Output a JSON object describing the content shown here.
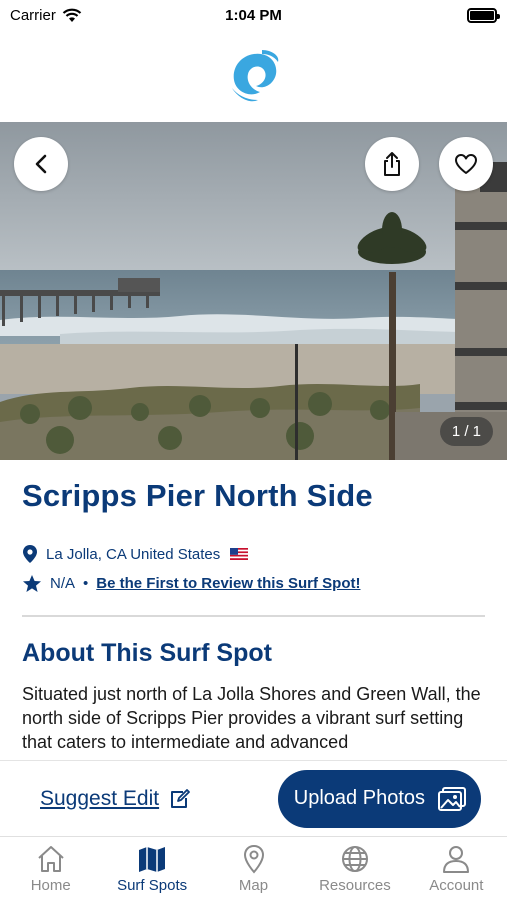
{
  "status_bar": {
    "carrier": "Carrier",
    "time": "1:04 PM"
  },
  "header": {
    "logo_icon": "wave-swirl-logo-icon"
  },
  "hero": {
    "photo_counter": "1 / 1",
    "buttons": {
      "back": "back-icon",
      "share": "share-icon",
      "favorite": "heart-icon"
    }
  },
  "spot": {
    "title": "Scripps Pier North Side",
    "location": "La Jolla, CA United States",
    "flag": "us-flag-icon",
    "rating": "N/A",
    "rating_separator": "•",
    "review_link": "Be the First to Review this Surf Spot!"
  },
  "about": {
    "heading": "About This Surf Spot",
    "description": "Situated just north of La Jolla Shores and Green Wall, the north side of Scripps Pier provides a vibrant surf setting that caters to intermediate and advanced"
  },
  "actions": {
    "suggest_edit": "Suggest Edit",
    "upload_photos": "Upload Photos"
  },
  "tabs": [
    {
      "label": "Home",
      "icon": "home-icon",
      "active": false
    },
    {
      "label": "Surf Spots",
      "icon": "map-folded-icon",
      "active": true
    },
    {
      "label": "Map",
      "icon": "map-pin-icon",
      "active": false
    },
    {
      "label": "Resources",
      "icon": "globe-icon",
      "active": false
    },
    {
      "label": "Account",
      "icon": "person-icon",
      "active": false
    }
  ],
  "colors": {
    "brand": "#0b3a78",
    "inactive_tab": "#8a8a8a",
    "logo": "#3aa7e0"
  }
}
